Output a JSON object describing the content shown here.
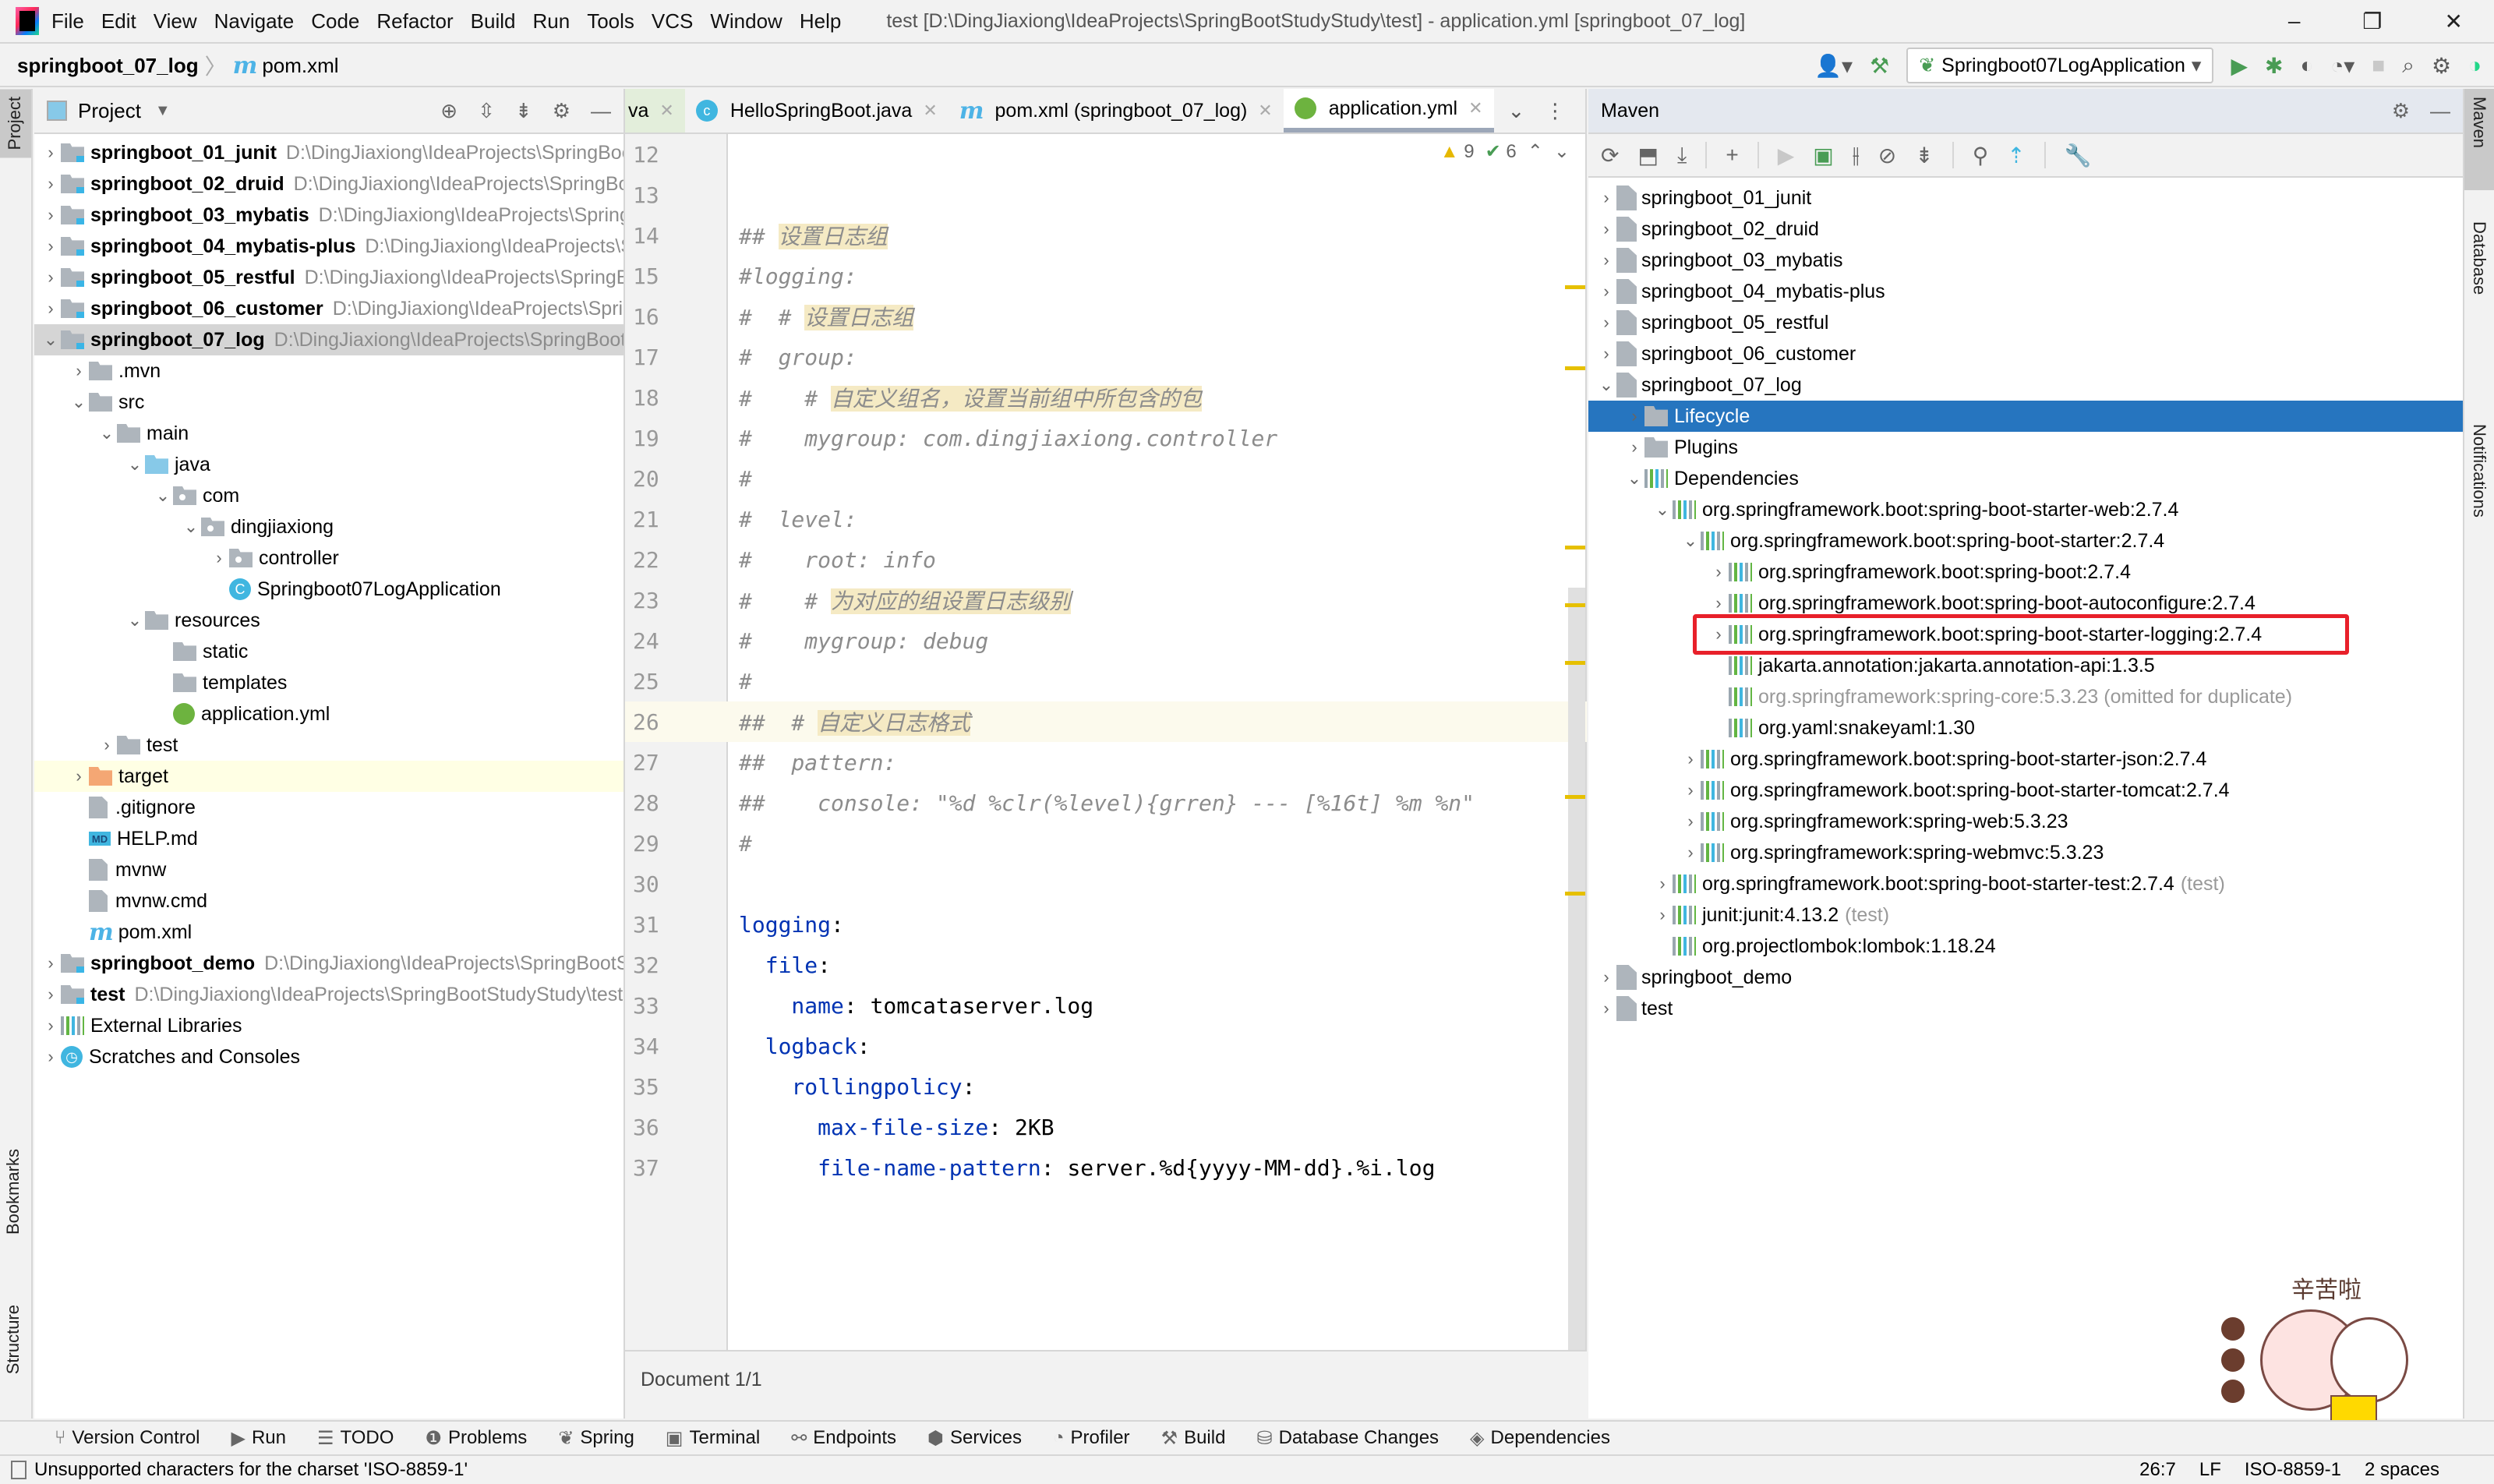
{
  "titlebar": {
    "menu": [
      "File",
      "Edit",
      "View",
      "Navigate",
      "Code",
      "Refactor",
      "Build",
      "Run",
      "Tools",
      "VCS",
      "Window",
      "Help"
    ],
    "window_title": "test [D:\\DingJiaxiong\\IdeaProjects\\SpringBootStudyStudy\\test] - application.yml [springboot_07_log]",
    "controls": [
      "minimize",
      "restore",
      "close"
    ]
  },
  "navbar": {
    "breadcrumb": [
      "springboot_07_log",
      "pom.xml"
    ],
    "run_config": "Springboot07LogApplication"
  },
  "left_strip": {
    "tabs": [
      "Project",
      "Bookmarks",
      "Structure"
    ]
  },
  "project": {
    "title": "Project",
    "tree": [
      {
        "name": "springboot_01_junit",
        "path": "D:\\DingJiaxiong\\IdeaProjects\\SpringBootStudyStudy",
        "level": 0,
        "type": "module",
        "expanded": false
      },
      {
        "name": "springboot_02_druid",
        "path": "D:\\DingJiaxiong\\IdeaProjects\\SpringBootStudyStudy",
        "level": 0,
        "type": "module",
        "expanded": false
      },
      {
        "name": "springboot_03_mybatis",
        "path": "D:\\DingJiaxiong\\IdeaProjects\\SpringBootStudyStudy",
        "level": 0,
        "type": "module",
        "expanded": false
      },
      {
        "name": "springboot_04_mybatis-plus",
        "path": "D:\\DingJiaxiong\\IdeaProjects\\SpringBootStudyStudy",
        "level": 0,
        "type": "module",
        "expanded": false
      },
      {
        "name": "springboot_05_restful",
        "path": "D:\\DingJiaxiong\\IdeaProjects\\SpringBootStudyStudy",
        "level": 0,
        "type": "module",
        "expanded": false
      },
      {
        "name": "springboot_06_customer",
        "path": "D:\\DingJiaxiong\\IdeaProjects\\SpringBootStudyStudy",
        "level": 0,
        "type": "module",
        "expanded": false
      },
      {
        "name": "springboot_07_log",
        "path": "D:\\DingJiaxiong\\IdeaProjects\\SpringBootStudyStudy",
        "level": 0,
        "type": "module",
        "expanded": true,
        "selected": true
      },
      {
        "name": ".mvn",
        "level": 1,
        "type": "folder",
        "expanded": false
      },
      {
        "name": "src",
        "level": 1,
        "type": "folder",
        "expanded": true
      },
      {
        "name": "main",
        "level": 2,
        "type": "folder",
        "expanded": true
      },
      {
        "name": "java",
        "level": 3,
        "type": "folder-blue",
        "expanded": true
      },
      {
        "name": "com",
        "level": 4,
        "type": "package",
        "expanded": true
      },
      {
        "name": "dingjiaxiong",
        "level": 5,
        "type": "package",
        "expanded": true
      },
      {
        "name": "controller",
        "level": 6,
        "type": "package",
        "expanded": false
      },
      {
        "name": "Springboot07LogApplication",
        "level": 6,
        "type": "class"
      },
      {
        "name": "resources",
        "level": 3,
        "type": "folder",
        "expanded": true
      },
      {
        "name": "static",
        "level": 4,
        "type": "folder"
      },
      {
        "name": "templates",
        "level": 4,
        "type": "folder"
      },
      {
        "name": "application.yml",
        "level": 4,
        "type": "spring"
      },
      {
        "name": "test",
        "level": 2,
        "type": "folder",
        "expanded": false
      },
      {
        "name": "target",
        "level": 1,
        "type": "folder-orange",
        "expanded": false,
        "highlighted": true
      },
      {
        "name": ".gitignore",
        "level": 1,
        "type": "file"
      },
      {
        "name": "HELP.md",
        "level": 1,
        "type": "md"
      },
      {
        "name": "mvnw",
        "level": 1,
        "type": "file"
      },
      {
        "name": "mvnw.cmd",
        "level": 1,
        "type": "file"
      },
      {
        "name": "pom.xml",
        "level": 1,
        "type": "pom"
      },
      {
        "name": "springboot_demo",
        "path": "D:\\DingJiaxiong\\IdeaProjects\\SpringBootStudyStudy",
        "level": 0,
        "type": "module",
        "expanded": false
      },
      {
        "name": "test",
        "path": "D:\\DingJiaxiong\\IdeaProjects\\SpringBootStudyStudy\\test",
        "level": 0,
        "type": "module",
        "expanded": false
      },
      {
        "name": "External Libraries",
        "level": 0,
        "type": "libs",
        "expanded": false
      },
      {
        "name": "Scratches and Consoles",
        "level": 0,
        "type": "scratch",
        "expanded": false
      }
    ]
  },
  "editor": {
    "tabs": [
      {
        "label": "va",
        "icon": "java-file-icon",
        "active": false
      },
      {
        "label": "HelloSpringBoot.java",
        "icon": "class-icon",
        "active": false
      },
      {
        "label": "pom.xml (springboot_07_log)",
        "icon": "maven-icon",
        "active": false
      },
      {
        "label": "application.yml",
        "icon": "spring-icon",
        "active": true
      }
    ],
    "inspections": {
      "warnings": "9",
      "weak_warnings": "6"
    },
    "lines": [
      {
        "n": "12",
        "parts": []
      },
      {
        "n": "13",
        "parts": []
      },
      {
        "n": "14",
        "parts": [
          {
            "t": "## ",
            "c": "cm"
          },
          {
            "t": "设置日志组",
            "c": "cm cmh"
          }
        ]
      },
      {
        "n": "15",
        "parts": [
          {
            "t": "#logging:",
            "c": "cm"
          }
        ]
      },
      {
        "n": "16",
        "parts": [
          {
            "t": "#  # ",
            "c": "cm"
          },
          {
            "t": "设置日志组",
            "c": "cm cmh"
          }
        ]
      },
      {
        "n": "17",
        "parts": [
          {
            "t": "#  group:",
            "c": "cm"
          }
        ]
      },
      {
        "n": "18",
        "parts": [
          {
            "t": "#    # ",
            "c": "cm"
          },
          {
            "t": "自定义组名，设置当前组中所包含的包",
            "c": "cm cmh"
          }
        ]
      },
      {
        "n": "19",
        "parts": [
          {
            "t": "#    mygroup: com.dingjiaxiong.controller",
            "c": "cm"
          }
        ]
      },
      {
        "n": "20",
        "parts": [
          {
            "t": "#",
            "c": "cm"
          }
        ]
      },
      {
        "n": "21",
        "parts": [
          {
            "t": "#  level:",
            "c": "cm"
          }
        ]
      },
      {
        "n": "22",
        "parts": [
          {
            "t": "#    root: info",
            "c": "cm"
          }
        ]
      },
      {
        "n": "23",
        "parts": [
          {
            "t": "#    # ",
            "c": "cm"
          },
          {
            "t": "为对应的组设置日志级别",
            "c": "cm cmh"
          }
        ]
      },
      {
        "n": "24",
        "parts": [
          {
            "t": "#    mygroup: debug",
            "c": "cm"
          }
        ]
      },
      {
        "n": "25",
        "parts": [
          {
            "t": "#",
            "c": "cm"
          }
        ]
      },
      {
        "n": "26",
        "parts": [
          {
            "t": "##  # ",
            "c": "cm"
          },
          {
            "t": "自定义日志格式",
            "c": "cm cmh"
          }
        ],
        "current": true
      },
      {
        "n": "27",
        "parts": [
          {
            "t": "##  pattern:",
            "c": "cm"
          }
        ]
      },
      {
        "n": "28",
        "parts": [
          {
            "t": "##    console: \"%d %clr(%level){grren} --- [%16t] %m %n\"",
            "c": "cm"
          }
        ]
      },
      {
        "n": "29",
        "parts": [
          {
            "t": "#",
            "c": "cm"
          }
        ]
      },
      {
        "n": "30",
        "parts": []
      },
      {
        "n": "31",
        "parts": [
          {
            "t": "logging",
            "c": "key"
          },
          {
            "t": ":",
            "c": "val"
          }
        ]
      },
      {
        "n": "32",
        "parts": [
          {
            "t": "  file",
            "c": "key"
          },
          {
            "t": ":",
            "c": "val"
          }
        ]
      },
      {
        "n": "33",
        "parts": [
          {
            "t": "    name",
            "c": "key"
          },
          {
            "t": ": tomcataserver.log",
            "c": "val"
          }
        ]
      },
      {
        "n": "34",
        "parts": [
          {
            "t": "  logback",
            "c": "key"
          },
          {
            "t": ":",
            "c": "val"
          }
        ]
      },
      {
        "n": "35",
        "parts": [
          {
            "t": "    rollingpolicy",
            "c": "key"
          },
          {
            "t": ":",
            "c": "val"
          }
        ]
      },
      {
        "n": "36",
        "parts": [
          {
            "t": "      max-file-size",
            "c": "key"
          },
          {
            "t": ": 2KB",
            "c": "val"
          }
        ]
      },
      {
        "n": "37",
        "parts": [
          {
            "t": "      file-name-pattern",
            "c": "key"
          },
          {
            "t": ": server.%d{yyyy-MM-dd}.%i.log",
            "c": "val"
          }
        ]
      }
    ],
    "doc_status": "Document 1/1"
  },
  "maven": {
    "title": "Maven",
    "tree": [
      {
        "label": "springboot_01_junit",
        "level": 0,
        "type": "pom",
        "chev": ">"
      },
      {
        "label": "springboot_02_druid",
        "level": 0,
        "type": "pom",
        "chev": ">"
      },
      {
        "label": "springboot_03_mybatis",
        "level": 0,
        "type": "pom",
        "chev": ">"
      },
      {
        "label": "springboot_04_mybatis-plus",
        "level": 0,
        "type": "pom",
        "chev": ">"
      },
      {
        "label": "springboot_05_restful",
        "level": 0,
        "type": "pom",
        "chev": ">"
      },
      {
        "label": "springboot_06_customer",
        "level": 0,
        "type": "pom",
        "chev": ">"
      },
      {
        "label": "springboot_07_log",
        "level": 0,
        "type": "pom",
        "chev": "v"
      },
      {
        "label": "Lifecycle",
        "level": 1,
        "type": "gear-folder",
        "chev": ">",
        "selected": true
      },
      {
        "label": "Plugins",
        "level": 1,
        "type": "gear-folder",
        "chev": ">"
      },
      {
        "label": "Dependencies",
        "level": 1,
        "type": "deps",
        "chev": "v"
      },
      {
        "label": "org.springframework.boot:spring-boot-starter-web:2.7.4",
        "level": 2,
        "type": "lib",
        "chev": "v"
      },
      {
        "label": "org.springframework.boot:spring-boot-starter:2.7.4",
        "level": 3,
        "type": "lib",
        "chev": "v"
      },
      {
        "label": "org.springframework.boot:spring-boot:2.7.4",
        "level": 4,
        "type": "lib",
        "chev": ">"
      },
      {
        "label": "org.springframework.boot:spring-boot-autoconfigure:2.7.4",
        "level": 4,
        "type": "lib",
        "chev": ">"
      },
      {
        "label": "org.springframework.boot:spring-boot-starter-logging:2.7.4",
        "level": 4,
        "type": "lib",
        "chev": ">",
        "boxed": true
      },
      {
        "label": "jakarta.annotation:jakarta.annotation-api:1.3.5",
        "level": 4,
        "type": "lib",
        "chev": ""
      },
      {
        "label": "org.springframework:spring-core:5.3.23 (omitted for duplicate)",
        "level": 4,
        "type": "lib",
        "chev": "",
        "dim": true
      },
      {
        "label": "org.yaml:snakeyaml:1.30",
        "level": 4,
        "type": "lib",
        "chev": ""
      },
      {
        "label": "org.springframework.boot:spring-boot-starter-json:2.7.4",
        "level": 3,
        "type": "lib",
        "chev": ">"
      },
      {
        "label": "org.springframework.boot:spring-boot-starter-tomcat:2.7.4",
        "level": 3,
        "type": "lib",
        "chev": ">"
      },
      {
        "label": "org.springframework:spring-web:5.3.23",
        "level": 3,
        "type": "lib",
        "chev": ">"
      },
      {
        "label": "org.springframework:spring-webmvc:5.3.23",
        "level": 3,
        "type": "lib",
        "chev": ">"
      },
      {
        "label": "org.springframework.boot:spring-boot-starter-test:2.7.4",
        "scope": "(test)",
        "level": 2,
        "type": "lib",
        "chev": ">"
      },
      {
        "label": "junit:junit:4.13.2",
        "scope": "(test)",
        "level": 2,
        "type": "lib",
        "chev": ">"
      },
      {
        "label": "org.projectlombok:lombok:1.18.24",
        "level": 2,
        "type": "lib",
        "chev": ""
      },
      {
        "label": "springboot_demo",
        "level": 0,
        "type": "pom",
        "chev": ">"
      },
      {
        "label": "test",
        "level": 0,
        "type": "pom",
        "chev": ">"
      }
    ]
  },
  "right_strip": {
    "tabs": [
      "Maven",
      "Database",
      "Notifications"
    ]
  },
  "bottom_tools": [
    {
      "label": "Version Control",
      "icon": "⑂"
    },
    {
      "label": "Run",
      "icon": "▶"
    },
    {
      "label": "TODO",
      "icon": "☰"
    },
    {
      "label": "Problems",
      "icon": "❶"
    },
    {
      "label": "Spring",
      "icon": "❦"
    },
    {
      "label": "Terminal",
      "icon": "▣"
    },
    {
      "label": "Endpoints",
      "icon": "⚯"
    },
    {
      "label": "Services",
      "icon": "⬢"
    },
    {
      "label": "Profiler",
      "icon": "◔"
    },
    {
      "label": "Build",
      "icon": "⚒"
    },
    {
      "label": "Database Changes",
      "icon": "⛁"
    },
    {
      "label": "Dependencies",
      "icon": "◈"
    }
  ],
  "status": {
    "message": "Unsupported characters for the charset 'ISO-8859-1'",
    "position": "26:7",
    "line_sep": "LF",
    "encoding": "ISO-8859-1",
    "indent": "2 spaces"
  },
  "sticker": {
    "caption": "辛苦啦"
  },
  "colors": {
    "selection": "#2675bf",
    "highlight_box": "#e8202a",
    "yaml_key": "#0033b3",
    "comment": "#8c8c8c"
  }
}
